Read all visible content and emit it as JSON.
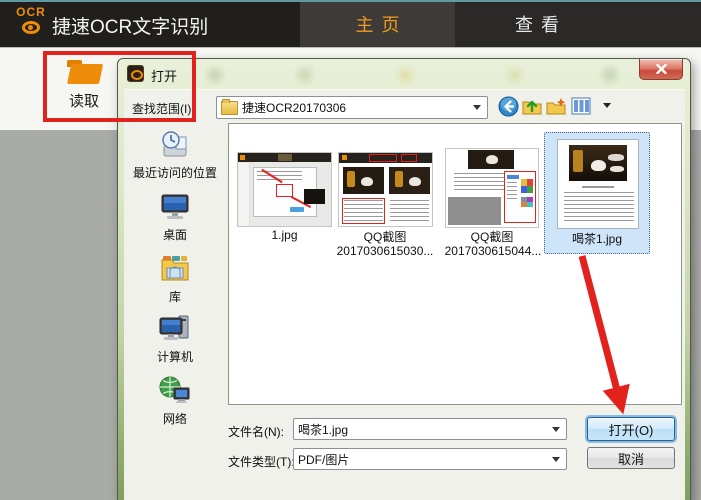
{
  "app": {
    "logo_text": "OCR",
    "title": "捷速OCR文字识别",
    "tabs": [
      {
        "label": "主页"
      },
      {
        "label": "查看"
      }
    ]
  },
  "ribbon": {
    "read_label": "读取"
  },
  "dialog": {
    "title": "打开",
    "lookup": {
      "label": "查找范围(I):",
      "value": "捷速OCR20170306"
    },
    "places": [
      {
        "label": "最近访问的位置"
      },
      {
        "label": "桌面"
      },
      {
        "label": "库"
      },
      {
        "label": "计算机"
      },
      {
        "label": "网络"
      }
    ],
    "files": [
      {
        "label_lines": [
          "1.jpg"
        ]
      },
      {
        "label_lines": [
          "QQ截图",
          "2017030615030..."
        ]
      },
      {
        "label_lines": [
          "QQ截图",
          "2017030615044..."
        ]
      },
      {
        "label_lines": [
          "喝茶1.jpg"
        ],
        "selected": true
      }
    ],
    "filename": {
      "label": "文件名(N):",
      "value": "喝茶1.jpg"
    },
    "filetype": {
      "label": "文件类型(T):",
      "value": "PDF/图片"
    },
    "buttons": {
      "open": "打开(O)",
      "cancel": "取消"
    }
  },
  "colors": {
    "accent_orange": "#ef9b1e",
    "annotation_red": "#e1221d",
    "selection_blue": "#cde4f9"
  }
}
